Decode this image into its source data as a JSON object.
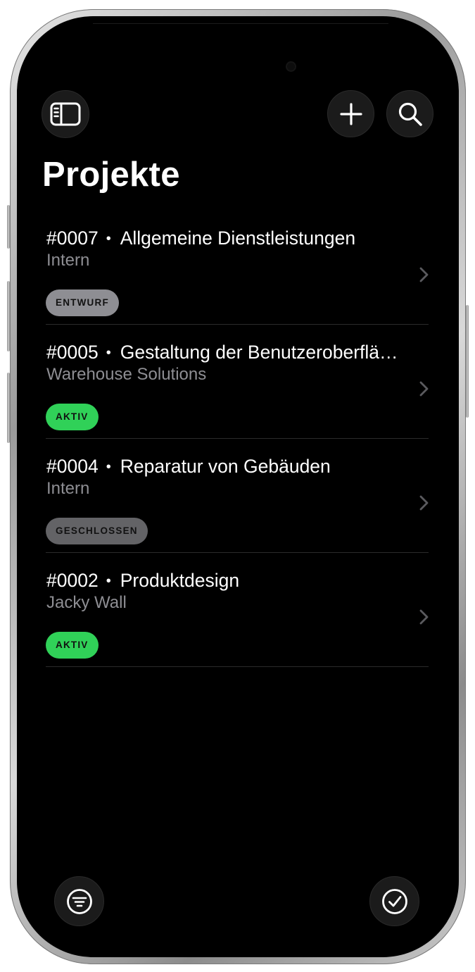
{
  "header": {
    "title": "Projekte"
  },
  "icons": {
    "sidebar": "sidebar-icon",
    "add": "plus-icon",
    "search": "search-icon",
    "filter": "filter-icon",
    "select": "checkmark-circle-icon",
    "chevron": "chevron-right-icon"
  },
  "colors": {
    "background": "#000000",
    "button_bg": "#1b1b1b",
    "secondary_text": "#8e8e93",
    "status_entwurf": "#8e8e93",
    "status_aktiv": "#30d158",
    "status_geschlossen": "#636366"
  },
  "projects": [
    {
      "number": "#0007",
      "name": "Allgemeine Dienstleistungen",
      "client": "Intern",
      "status": "ENTWURF",
      "status_color": "#8e8e93"
    },
    {
      "number": "#0005",
      "name": "Gestaltung der Benutzeroberfläche",
      "client": "Warehouse Solutions",
      "status": "AKTIV",
      "status_color": "#30d158"
    },
    {
      "number": "#0004",
      "name": "Reparatur von Gebäuden",
      "client": "Intern",
      "status": "GESCHLOSSEN",
      "status_color": "#636366"
    },
    {
      "number": "#0002",
      "name": "Produktdesign",
      "client": "Jacky Wall",
      "status": "AKTIV",
      "status_color": "#30d158"
    }
  ]
}
